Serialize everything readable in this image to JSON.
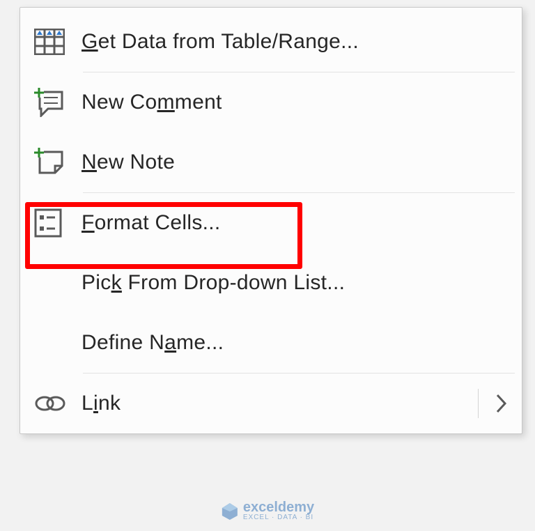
{
  "menu": {
    "items": [
      {
        "label_pre": "",
        "label_under": "G",
        "label_post": "et Data from Table/Range...",
        "icon": "table-icon"
      },
      {
        "label_pre": "New Co",
        "label_under": "m",
        "label_post": "ment",
        "icon": "comment-plus-icon"
      },
      {
        "label_pre": "",
        "label_under": "N",
        "label_post": "ew Note",
        "icon": "note-plus-icon"
      },
      {
        "label_pre": "",
        "label_under": "F",
        "label_post": "ormat Cells...",
        "icon": "format-cells-icon"
      },
      {
        "label_pre": "Pic",
        "label_under": "k",
        "label_post": " From Drop-down List...",
        "icon": ""
      },
      {
        "label_pre": "Define N",
        "label_under": "a",
        "label_post": "me...",
        "icon": ""
      },
      {
        "label_pre": "L",
        "label_under": "i",
        "label_post": "nk",
        "icon": "link-icon",
        "has_submenu": true
      }
    ]
  },
  "highlight": {
    "item_index": 3
  },
  "watermark": {
    "brand": "exceldemy",
    "tagline": "EXCEL · DATA · BI"
  }
}
